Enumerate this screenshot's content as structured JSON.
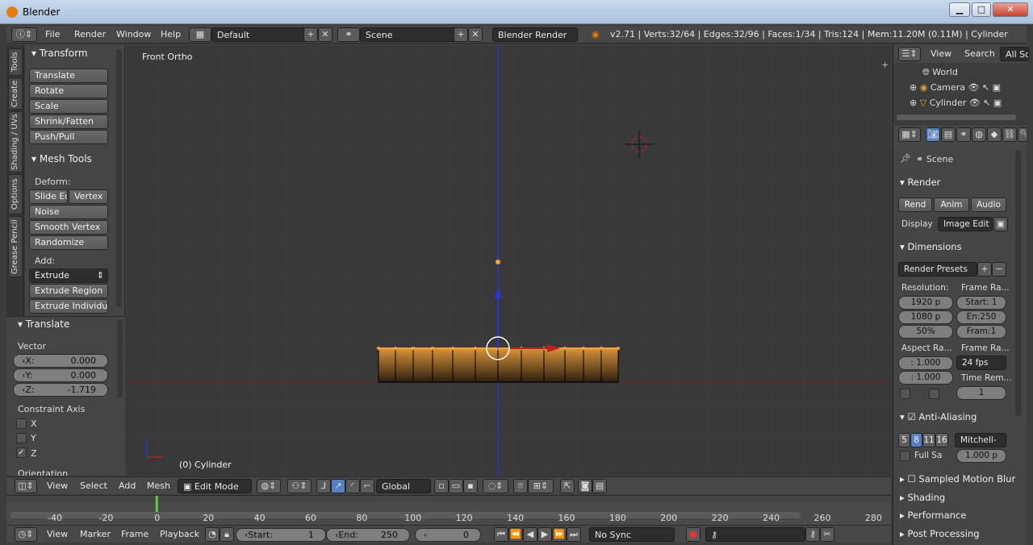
{
  "window": {
    "title": "Blender",
    "btn_min": "▁",
    "btn_max": "□",
    "btn_close": "✕"
  },
  "info_header": {
    "menus": [
      "File",
      "Render",
      "Window",
      "Help"
    ],
    "screen_layout": "Default",
    "scene": "Scene",
    "engine": "Blender Render",
    "stats": "v2.71 | Verts:32/64 | Edges:32/96 | Faces:1/34 | Tris:124 | Mem:11.20M (0.11M) | Cylinder"
  },
  "tabs": [
    "Tools",
    "Create",
    "Shading / UVs",
    "Options",
    "Grease Pencil"
  ],
  "tool_shelf": {
    "transform_header": "Transform",
    "transform_buttons": [
      "Translate",
      "Rotate",
      "Scale",
      "Shrink/Fatten",
      "Push/Pull"
    ],
    "mesh_tools_header": "Mesh Tools",
    "deform_label": "Deform:",
    "slide_edge": "Slide Ed",
    "vertex": "Vertex",
    "deform_buttons": [
      "Noise",
      "Smooth Vertex",
      "Randomize"
    ],
    "add_label": "Add:",
    "extrude": "Extrude",
    "add_buttons": [
      "Extrude Region",
      "Extrude Individual"
    ]
  },
  "operator_panel": {
    "header": "Translate",
    "vector_label": "Vector",
    "x_label": "X:",
    "x_value": "0.000",
    "y_label": "Y:",
    "y_value": "0.000",
    "z_label": "Z:",
    "z_value": "-1.719",
    "constraint_label": "Constraint Axis",
    "axis_x": "X",
    "axis_y": "Y",
    "axis_z": "Z",
    "orientation_label": "Orientation"
  },
  "viewport": {
    "view_name": "Front Ortho",
    "object_label": "(0) Cylinder"
  },
  "viewport_header": {
    "menus": [
      "View",
      "Select",
      "Add",
      "Mesh"
    ],
    "mode": "Edit Mode",
    "orientation": "Global"
  },
  "timeline": {
    "ticks": [
      "-40",
      "-20",
      "0",
      "20",
      "40",
      "60",
      "80",
      "100",
      "120",
      "140",
      "160",
      "180",
      "200",
      "220",
      "240",
      "260",
      "280"
    ],
    "current_frame_marker": 0
  },
  "timeline_header": {
    "menus": [
      "View",
      "Marker",
      "Frame",
      "Playback"
    ],
    "start_label": "Start:",
    "start_value": "1",
    "end_label": "End:",
    "end_value": "250",
    "current_value": "0",
    "sync": "No Sync"
  },
  "outliner": {
    "view": "View",
    "search": "Search",
    "filter": "All Sc",
    "items": [
      "World",
      "Camera",
      "Cylinder"
    ]
  },
  "properties": {
    "scene": "Scene",
    "render_header": "Render",
    "render_btn": "Rend",
    "anim_btn": "Anim",
    "audio_btn": "Audio",
    "display_label": "Display",
    "display_value": "Image Edit",
    "dimensions_header": "Dimensions",
    "render_presets": "Render Presets",
    "resolution_label": "Resolution:",
    "frame_range_label": "Frame Ra...",
    "res_x": "1920 p",
    "res_y": "1080 p",
    "res_pct": "50%",
    "start": "Start: 1",
    "end": "En:250",
    "step": "Fram:1",
    "aspect_label": "Aspect Ra...",
    "frame_rate_label": "Frame Ra...",
    "aspect_x": ": 1.000",
    "aspect_y": ": 1.000",
    "fps": "24 fps",
    "time_remap_label": "Time Rem...",
    "time_remap_value": "1",
    "aa_header": "Anti-Aliasing",
    "aa_samples": [
      "5",
      "8",
      "11",
      "16"
    ],
    "aa_filter": "Mitchell-",
    "full_sample": "Full Sa",
    "filter_size": "1.000 p",
    "sampled_motion_blur": "Sampled Motion Blur",
    "shading": "Shading",
    "performance": "Performance",
    "post_processing": "Post Processing"
  },
  "colors": {
    "accent": "#5680c2",
    "selected_vertex": "#f4a23a",
    "x_axis": "#c21f1f",
    "z_axis": "#2c37c4"
  }
}
